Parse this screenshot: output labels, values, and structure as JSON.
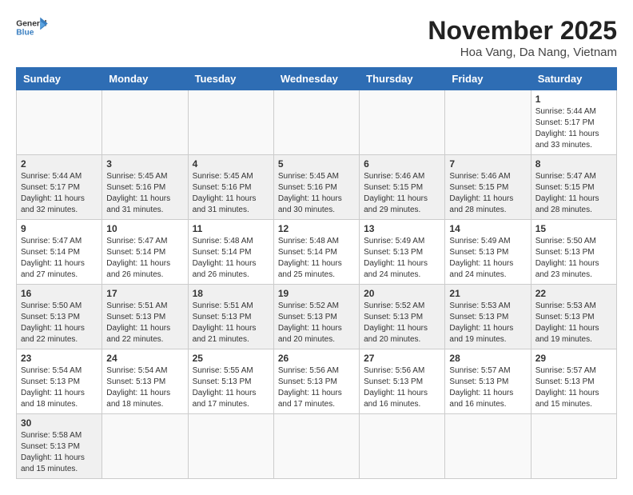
{
  "header": {
    "logo_general": "General",
    "logo_blue": "Blue",
    "title": "November 2025",
    "location": "Hoa Vang, Da Nang, Vietnam"
  },
  "weekdays": [
    "Sunday",
    "Monday",
    "Tuesday",
    "Wednesday",
    "Thursday",
    "Friday",
    "Saturday"
  ],
  "weeks": [
    [
      {
        "day": "",
        "info": ""
      },
      {
        "day": "",
        "info": ""
      },
      {
        "day": "",
        "info": ""
      },
      {
        "day": "",
        "info": ""
      },
      {
        "day": "",
        "info": ""
      },
      {
        "day": "",
        "info": ""
      },
      {
        "day": "1",
        "info": "Sunrise: 5:44 AM\nSunset: 5:17 PM\nDaylight: 11 hours\nand 33 minutes."
      }
    ],
    [
      {
        "day": "2",
        "info": "Sunrise: 5:44 AM\nSunset: 5:17 PM\nDaylight: 11 hours\nand 32 minutes."
      },
      {
        "day": "3",
        "info": "Sunrise: 5:45 AM\nSunset: 5:16 PM\nDaylight: 11 hours\nand 31 minutes."
      },
      {
        "day": "4",
        "info": "Sunrise: 5:45 AM\nSunset: 5:16 PM\nDaylight: 11 hours\nand 31 minutes."
      },
      {
        "day": "5",
        "info": "Sunrise: 5:45 AM\nSunset: 5:16 PM\nDaylight: 11 hours\nand 30 minutes."
      },
      {
        "day": "6",
        "info": "Sunrise: 5:46 AM\nSunset: 5:15 PM\nDaylight: 11 hours\nand 29 minutes."
      },
      {
        "day": "7",
        "info": "Sunrise: 5:46 AM\nSunset: 5:15 PM\nDaylight: 11 hours\nand 28 minutes."
      },
      {
        "day": "8",
        "info": "Sunrise: 5:47 AM\nSunset: 5:15 PM\nDaylight: 11 hours\nand 28 minutes."
      }
    ],
    [
      {
        "day": "9",
        "info": "Sunrise: 5:47 AM\nSunset: 5:14 PM\nDaylight: 11 hours\nand 27 minutes."
      },
      {
        "day": "10",
        "info": "Sunrise: 5:47 AM\nSunset: 5:14 PM\nDaylight: 11 hours\nand 26 minutes."
      },
      {
        "day": "11",
        "info": "Sunrise: 5:48 AM\nSunset: 5:14 PM\nDaylight: 11 hours\nand 26 minutes."
      },
      {
        "day": "12",
        "info": "Sunrise: 5:48 AM\nSunset: 5:14 PM\nDaylight: 11 hours\nand 25 minutes."
      },
      {
        "day": "13",
        "info": "Sunrise: 5:49 AM\nSunset: 5:13 PM\nDaylight: 11 hours\nand 24 minutes."
      },
      {
        "day": "14",
        "info": "Sunrise: 5:49 AM\nSunset: 5:13 PM\nDaylight: 11 hours\nand 24 minutes."
      },
      {
        "day": "15",
        "info": "Sunrise: 5:50 AM\nSunset: 5:13 PM\nDaylight: 11 hours\nand 23 minutes."
      }
    ],
    [
      {
        "day": "16",
        "info": "Sunrise: 5:50 AM\nSunset: 5:13 PM\nDaylight: 11 hours\nand 22 minutes."
      },
      {
        "day": "17",
        "info": "Sunrise: 5:51 AM\nSunset: 5:13 PM\nDaylight: 11 hours\nand 22 minutes."
      },
      {
        "day": "18",
        "info": "Sunrise: 5:51 AM\nSunset: 5:13 PM\nDaylight: 11 hours\nand 21 minutes."
      },
      {
        "day": "19",
        "info": "Sunrise: 5:52 AM\nSunset: 5:13 PM\nDaylight: 11 hours\nand 20 minutes."
      },
      {
        "day": "20",
        "info": "Sunrise: 5:52 AM\nSunset: 5:13 PM\nDaylight: 11 hours\nand 20 minutes."
      },
      {
        "day": "21",
        "info": "Sunrise: 5:53 AM\nSunset: 5:13 PM\nDaylight: 11 hours\nand 19 minutes."
      },
      {
        "day": "22",
        "info": "Sunrise: 5:53 AM\nSunset: 5:13 PM\nDaylight: 11 hours\nand 19 minutes."
      }
    ],
    [
      {
        "day": "23",
        "info": "Sunrise: 5:54 AM\nSunset: 5:13 PM\nDaylight: 11 hours\nand 18 minutes."
      },
      {
        "day": "24",
        "info": "Sunrise: 5:54 AM\nSunset: 5:13 PM\nDaylight: 11 hours\nand 18 minutes."
      },
      {
        "day": "25",
        "info": "Sunrise: 5:55 AM\nSunset: 5:13 PM\nDaylight: 11 hours\nand 17 minutes."
      },
      {
        "day": "26",
        "info": "Sunrise: 5:56 AM\nSunset: 5:13 PM\nDaylight: 11 hours\nand 17 minutes."
      },
      {
        "day": "27",
        "info": "Sunrise: 5:56 AM\nSunset: 5:13 PM\nDaylight: 11 hours\nand 16 minutes."
      },
      {
        "day": "28",
        "info": "Sunrise: 5:57 AM\nSunset: 5:13 PM\nDaylight: 11 hours\nand 16 minutes."
      },
      {
        "day": "29",
        "info": "Sunrise: 5:57 AM\nSunset: 5:13 PM\nDaylight: 11 hours\nand 15 minutes."
      }
    ],
    [
      {
        "day": "30",
        "info": "Sunrise: 5:58 AM\nSunset: 5:13 PM\nDaylight: 11 hours\nand 15 minutes."
      },
      {
        "day": "",
        "info": ""
      },
      {
        "day": "",
        "info": ""
      },
      {
        "day": "",
        "info": ""
      },
      {
        "day": "",
        "info": ""
      },
      {
        "day": "",
        "info": ""
      },
      {
        "day": "",
        "info": ""
      }
    ]
  ]
}
